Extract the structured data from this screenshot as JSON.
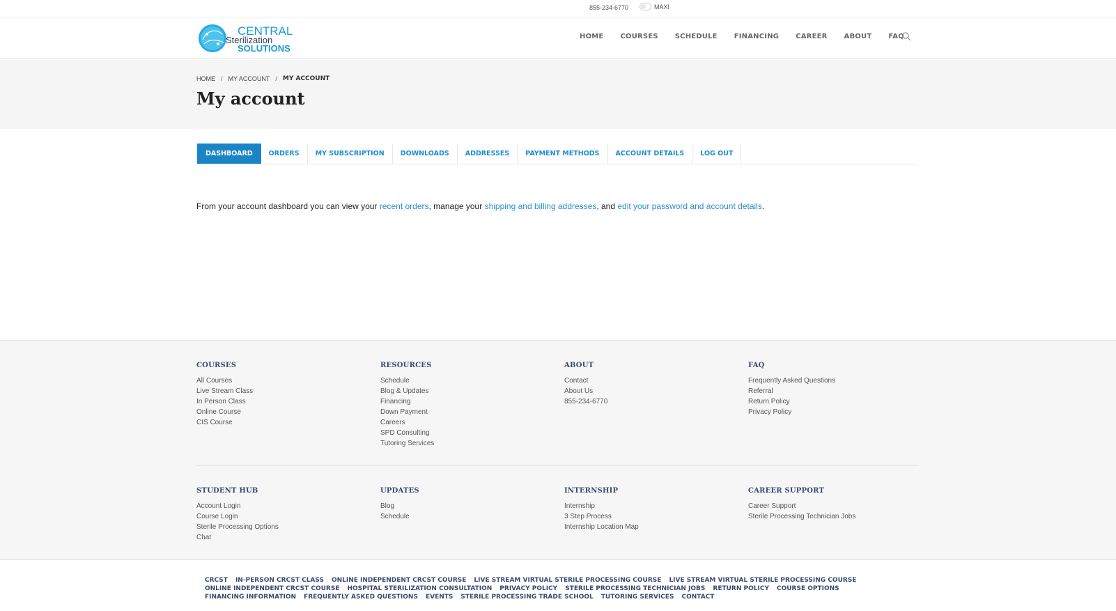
{
  "topbar": {
    "phone": "855-234-6770",
    "mode_label": "MAXI"
  },
  "header": {
    "logo_text": {
      "line1": "CENTRAL",
      "line2": "Sterilization",
      "line3": "SOLUTIONS"
    },
    "nav": [
      "HOME",
      "COURSES",
      "SCHEDULE",
      "FINANCING",
      "CAREER",
      "ABOUT",
      "FAQ"
    ]
  },
  "breadcrumb": [
    "HOME",
    "MY ACCOUNT",
    "MY ACCOUNT"
  ],
  "page_title": "My account",
  "tabs": [
    "DASHBOARD",
    "ORDERS",
    "MY SUBSCRIPTION",
    "DOWNLOADS",
    "ADDRESSES",
    "PAYMENT METHODS",
    "ACCOUNT DETAILS",
    "LOG OUT"
  ],
  "dashboard": {
    "t1": "From your account dashboard you can view your ",
    "link1": "recent orders",
    "t2": ", manage your ",
    "link2": "shipping and billing addresses",
    "t3": ", and ",
    "link3": "edit your password and account details",
    "t4": "."
  },
  "footer": {
    "row1": [
      {
        "title": "COURSES",
        "items": [
          "All Courses",
          "Live Stream Class",
          "In Person Class",
          "Online Course",
          "CIS Course"
        ]
      },
      {
        "title": "RESOURCES",
        "items": [
          "Schedule",
          "Blog & Updates",
          "Financing",
          "Down Payment",
          "Careers",
          "SPD Consulting",
          "Tutoring Services"
        ]
      },
      {
        "title": "ABOUT",
        "items": [
          "Contact",
          "About Us",
          "855-234-6770"
        ]
      },
      {
        "title": "FAQ",
        "items": [
          "Frequently Asked Questions",
          "Referral",
          "Return Policy",
          "Privacy Policy"
        ]
      }
    ],
    "row2": [
      {
        "title": "STUDENT HUB",
        "items": [
          "Account Login",
          "Course Login",
          "Sterile Processing Options",
          "Chat"
        ]
      },
      {
        "title": "UPDATES",
        "items": [
          "Blog",
          "Schedule"
        ]
      },
      {
        "title": "INTERNSHIP",
        "items": [
          "Internship",
          "3 Step Process",
          "Internship Location Map"
        ]
      },
      {
        "title": "CAREER SUPPORT",
        "items": [
          "Career Support",
          "Sterile Processing Technician Jobs"
        ]
      }
    ],
    "bottom_links": [
      [
        "CRCST",
        "IN-PERSON CRCST CLASS",
        "ONLINE INDEPENDENT CRCST COURSE",
        "LIVE STREAM VIRTUAL STERILE PROCESSING COURSE",
        "LIVE STREAM VIRTUAL STERILE PROCESSING COURSE"
      ],
      [
        "ONLINE INDEPENDENT CRCST COURSE",
        "HOSPITAL STERILIZATION CONSULTATION",
        "PRIVACY POLICY",
        "STERILE PROCESSING TECHNICIAN JOBS",
        "RETURN POLICY",
        "COURSE OPTIONS"
      ],
      [
        "FINANCING INFORMATION",
        "FREQUENTLY ASKED QUESTIONS",
        "EVENTS",
        "STERILE PROCESSING TRADE SCHOOL",
        "TUTORING SERVICES",
        "CONTACT"
      ]
    ]
  }
}
